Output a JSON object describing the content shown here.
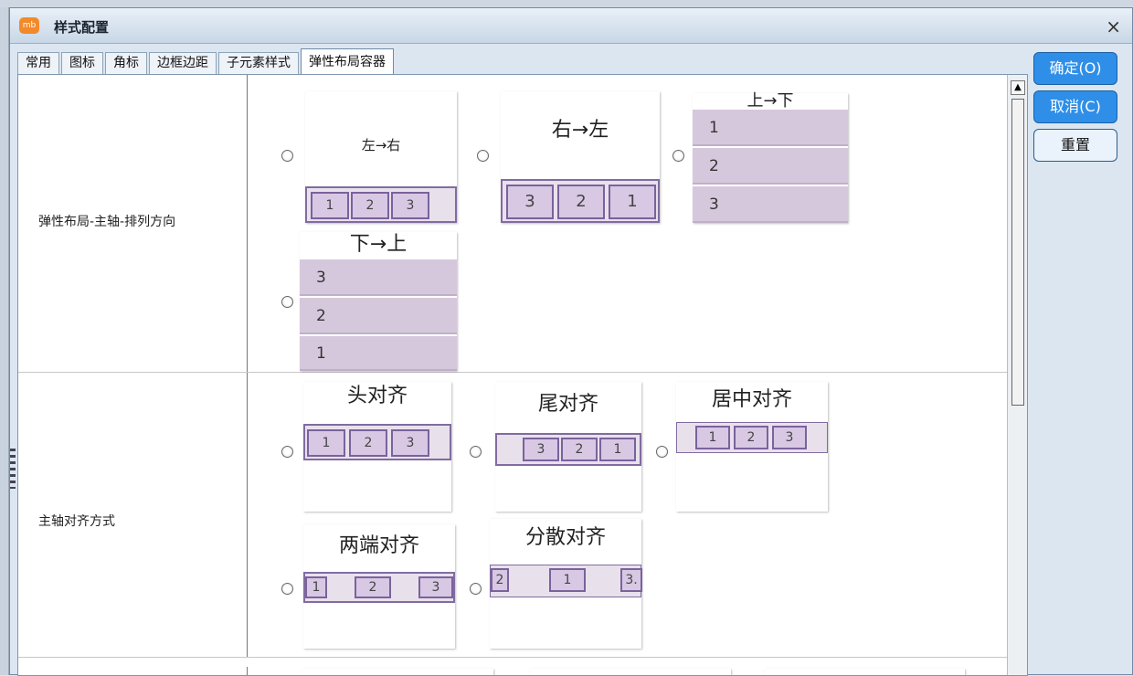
{
  "dialog": {
    "title": "样式配置",
    "icon_text": "mb",
    "close_icon": "×"
  },
  "tabs": [
    {
      "label": "常用"
    },
    {
      "label": "图标"
    },
    {
      "label": "角标"
    },
    {
      "label": "边框边距"
    },
    {
      "label": "子元素样式"
    },
    {
      "label": "弹性布局容器",
      "active": true
    }
  ],
  "sections": {
    "direction": {
      "label": "弹性布局-主轴-排列方向",
      "options": [
        {
          "title": "左→右",
          "items": [
            "1",
            "2",
            "3"
          ]
        },
        {
          "title": "右→左",
          "items": [
            "3",
            "2",
            "1"
          ]
        },
        {
          "title": "上→下",
          "items": [
            "1",
            "2",
            "3"
          ]
        },
        {
          "title": "下→上",
          "items": [
            "3",
            "2",
            "1"
          ]
        }
      ]
    },
    "justify": {
      "label": "主轴对齐方式",
      "options": [
        {
          "title": "头对齐",
          "items": [
            "1",
            "2",
            "3"
          ]
        },
        {
          "title": "尾对齐",
          "items": [
            "3",
            "2",
            "1"
          ]
        },
        {
          "title": "居中对齐",
          "items": [
            "1",
            "2",
            "3"
          ]
        },
        {
          "title": "两端对齐",
          "items": [
            "1",
            "2",
            "3"
          ]
        },
        {
          "title": "分散对齐",
          "items": [
            "2",
            "1",
            "3."
          ]
        }
      ]
    }
  },
  "buttons": {
    "ok": "确定(O)",
    "cancel": "取消(C)",
    "reset": "重置"
  },
  "colors": {
    "accent_blue": "#2f8fe8",
    "item_purple": "#d8c8e4",
    "border_purple": "#7a629c"
  }
}
